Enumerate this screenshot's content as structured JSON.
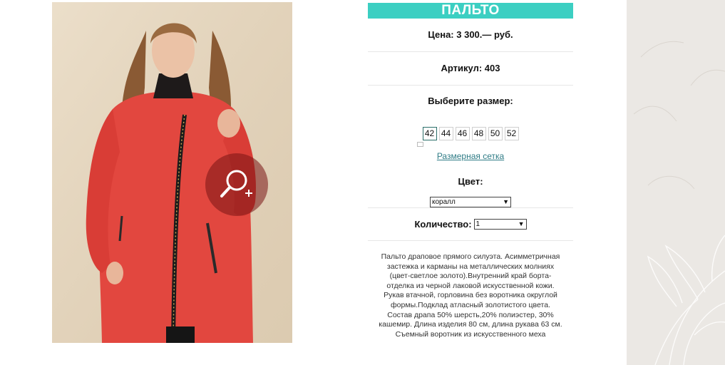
{
  "product": {
    "title": "ПАЛЬТО",
    "price": "Цена: 3 300.— руб.",
    "sku": "Артикул: 403",
    "choose_size_label": "Выберите размер:",
    "sizes": [
      "42",
      "44",
      "46",
      "48",
      "50",
      "52"
    ],
    "selected_size": "42",
    "size_chart_link": "Размерная сетка",
    "color_label": "Цвет:",
    "color_value": "коралл",
    "quantity_label": "Количество:",
    "quantity_value": "1",
    "description": "Пальто драповое прямого силуэта. Асимметричная застежка и карманы на металлических молниях (цвет-светлое золото).Внутренний край борта-отделка из черной лаковой искусственной кожи. Рукав втачной, горловина без воротника округлой формы.Подклад атласный золотистого цвета. Состав драпа 50% шерсть,20% полиэстер, 30% кашемир. Длина изделия 80 см, длина рукава 63 см. Съемный воротник из искусственного меха"
  },
  "colors": {
    "accent": "#3ccfc2",
    "link": "#2f7c86",
    "coat": "#e2473f",
    "panel": "#ebe8e4"
  },
  "icons": {
    "zoom": "zoom-in-icon",
    "dropdown": "chevron-down-icon"
  }
}
